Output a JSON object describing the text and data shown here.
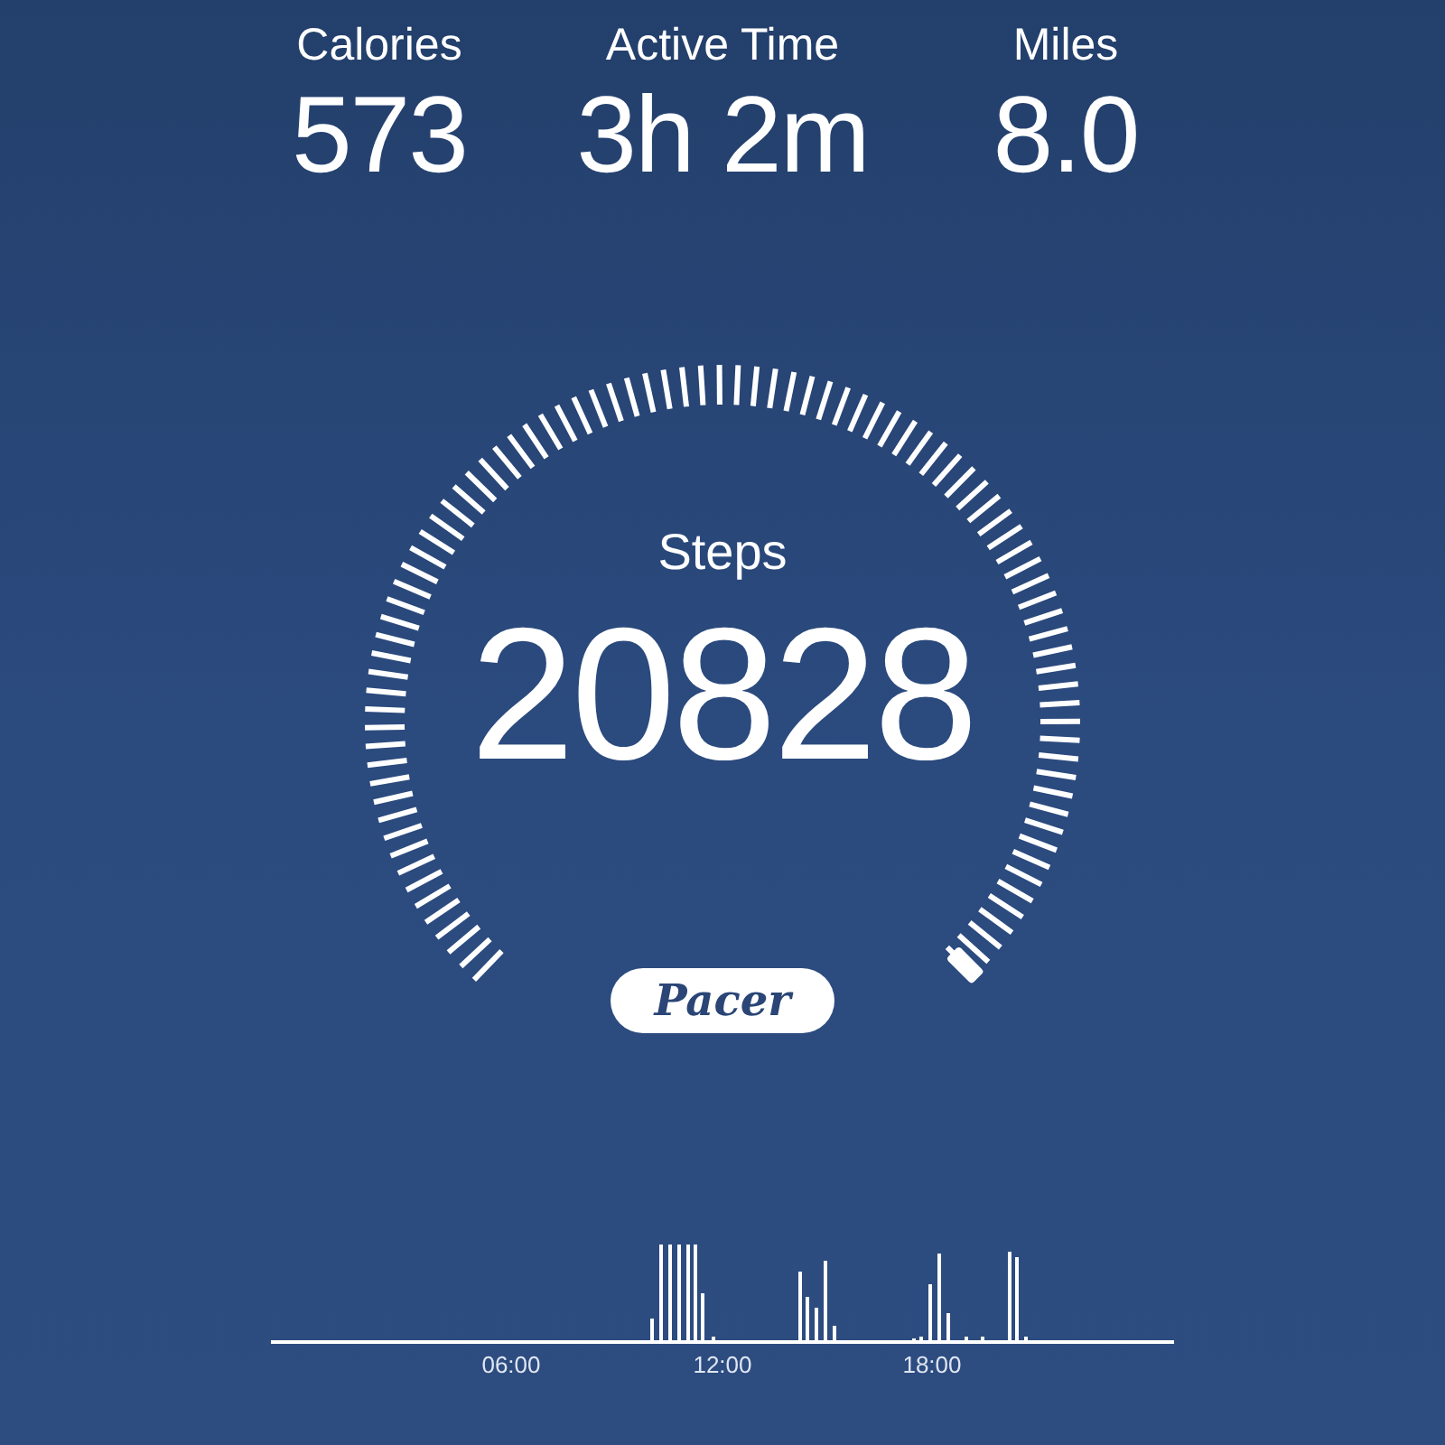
{
  "stats": [
    {
      "label": "Calories",
      "value": "573"
    },
    {
      "label": "Active Time",
      "value": "3h 2m"
    },
    {
      "label": "Miles",
      "value": "8.0"
    }
  ],
  "steps": {
    "label": "Steps",
    "value": "20828"
  },
  "brand": "Pacer",
  "activity": {
    "time_labels": [
      "06:00",
      "12:00",
      "18:00"
    ]
  }
}
